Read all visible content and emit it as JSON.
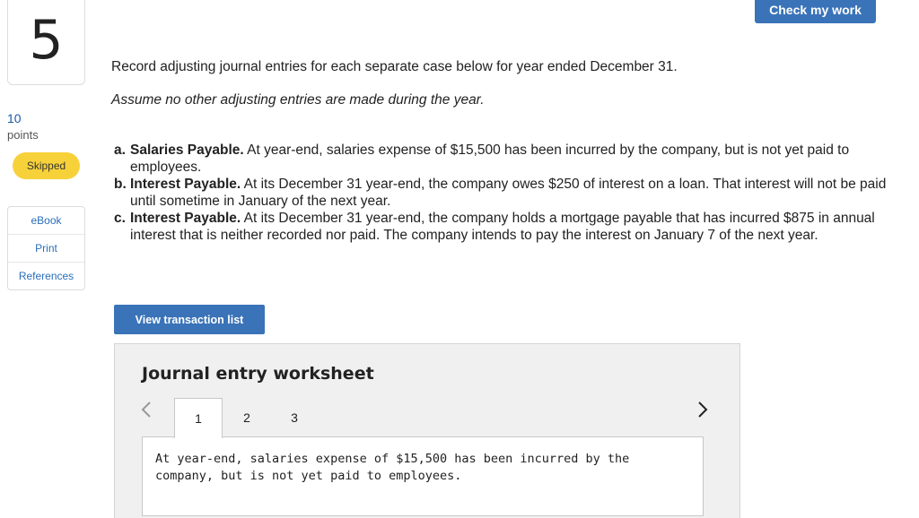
{
  "question": {
    "number": "5"
  },
  "score": {
    "points_value": "10",
    "points_label": "points",
    "status": "Skipped"
  },
  "side_links": [
    "eBook",
    "Print",
    "References"
  ],
  "header": {
    "check_button": "Check my work"
  },
  "instructions": {
    "main": "Record adjusting journal entries for each separate case below for year ended December 31.",
    "note": "Assume no other adjusting entries are made during the year."
  },
  "cases": [
    {
      "label": "a.",
      "title": "Salaries Payable.",
      "text": " At year-end, salaries expense of $15,500 has been incurred by the company, but is not yet paid to employees."
    },
    {
      "label": "b.",
      "title": "Interest Payable.",
      "text": " At its December 31 year-end, the company owes $250 of interest on a loan. That interest will not be paid until sometime in January of the next year."
    },
    {
      "label": "c.",
      "title": "Interest Payable.",
      "text": " At its December 31 year-end, the company holds a mortgage payable that has incurred $875 in annual interest that is neither recorded nor paid. The company intends to pay the interest on January 7 of the next year."
    }
  ],
  "view_button": "View transaction list",
  "worksheet": {
    "title": "Journal entry worksheet",
    "tabs": [
      "1",
      "2",
      "3"
    ],
    "active_tab": "1",
    "prev_icon": "chevron-left-icon",
    "next_icon": "chevron-right-icon",
    "description": "At year-end, salaries expense of $15,500 has been incurred by the company, but is not yet paid to employees."
  }
}
